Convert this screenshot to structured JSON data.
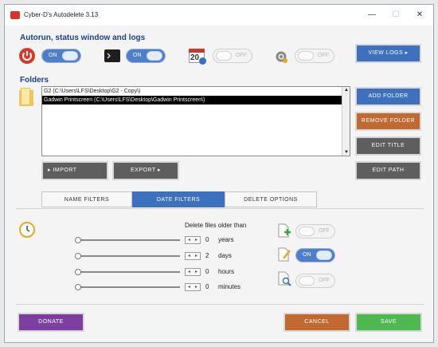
{
  "window": {
    "title": "Cyber-D's Autodelete 3.13"
  },
  "autorun": {
    "heading": "Autorun, status window and logs",
    "toggles": [
      {
        "state": "ON"
      },
      {
        "state": "ON"
      },
      {
        "state": "OFF",
        "calendar_day": "20"
      },
      {
        "state": "OFF"
      }
    ],
    "view_logs": "VIEW LOGS  ▸"
  },
  "folders": {
    "heading": "Folders",
    "rows": [
      "G2    (C:\\Users\\LFS\\Desktop\\G2 - Copy\\)",
      "Gadwin Printscreen    (C:\\Users\\LFS\\Desktop\\Gadwin Printscreen\\)"
    ],
    "add": "ADD FOLDER",
    "remove": "REMOVE FOLDER",
    "edit_title": "EDIT TITLE",
    "edit_path": "EDIT PATH",
    "import": "▸   IMPORT",
    "export": "EXPORT   ▸"
  },
  "tabs": [
    "NAME FILTERS",
    "DATE FILTERS",
    "DELETE OPTIONS"
  ],
  "date_filters": {
    "caption": "Delete files older than",
    "rows": [
      {
        "value": "0",
        "unit": "years"
      },
      {
        "value": "2",
        "unit": "days"
      },
      {
        "value": "0",
        "unit": "hours"
      },
      {
        "value": "0",
        "unit": "minutes"
      }
    ],
    "option_toggles": [
      {
        "state": "OFF"
      },
      {
        "state": "ON"
      },
      {
        "state": "OFF"
      }
    ]
  },
  "footer": {
    "donate": "DONATE",
    "cancel": "CANCEL",
    "save": "SAVE"
  }
}
